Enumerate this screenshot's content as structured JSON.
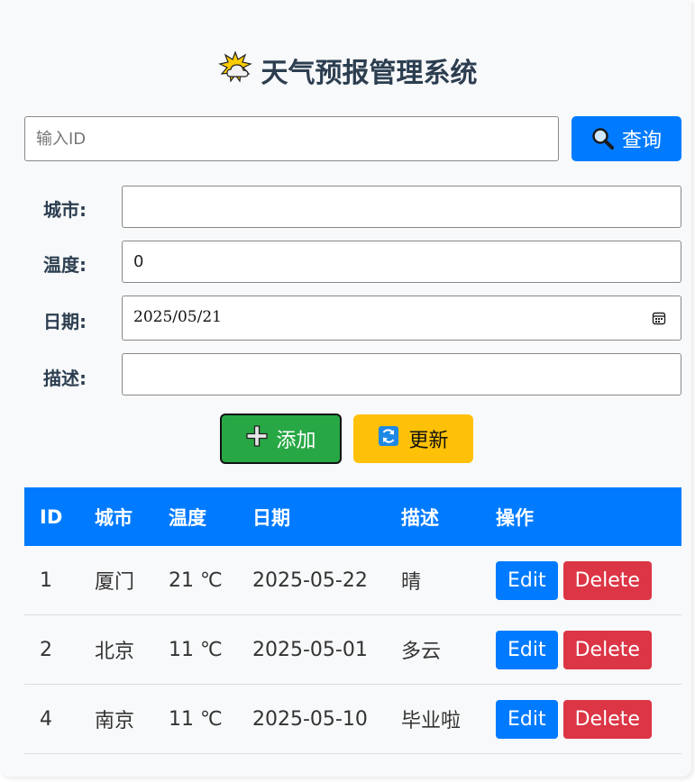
{
  "header": {
    "title": "天气预报管理系统",
    "title_icon": "sun-behind-cloud-icon"
  },
  "search": {
    "placeholder": "输入ID",
    "value": "",
    "button_label": "查询",
    "button_icon": "magnifier-icon",
    "button_color": "#007bff"
  },
  "form": {
    "city_label": "城市:",
    "city_value": "",
    "temp_label": "温度:",
    "temp_value": "0",
    "date_label": "日期:",
    "date_value": "2025/05/21",
    "date_icon": "calendar-icon",
    "desc_label": "描述:",
    "desc_value": ""
  },
  "actions": {
    "add_label": "添加",
    "add_icon": "plus-icon",
    "add_color": "#28a745",
    "update_label": "更新",
    "update_icon": "refresh-icon",
    "update_color": "#ffc107"
  },
  "table": {
    "header_color": "#007bff",
    "columns": [
      "ID",
      "城市",
      "温度",
      "日期",
      "描述",
      "操作"
    ],
    "rows": [
      {
        "id": "1",
        "city": "厦门",
        "temp": "21 ℃",
        "date": "2025-05-22",
        "desc": "晴"
      },
      {
        "id": "2",
        "city": "北京",
        "temp": "11 ℃",
        "date": "2025-05-01",
        "desc": "多云"
      },
      {
        "id": "4",
        "city": "南京",
        "temp": "11 ℃",
        "date": "2025-05-10",
        "desc": "毕业啦"
      }
    ],
    "edit_label": "Edit",
    "delete_label": "Delete",
    "edit_color": "#007bff",
    "delete_color": "#dc3545"
  }
}
